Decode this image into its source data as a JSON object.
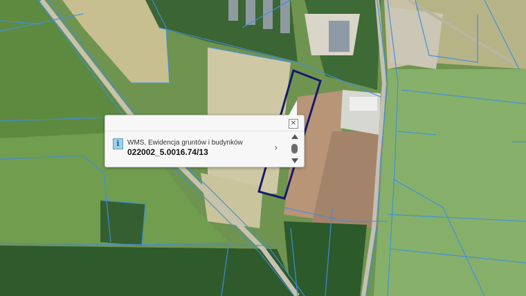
{
  "map": {
    "colors": {
      "parcel_lines": "#3f8fe0",
      "selected_parcel": "#141a6b",
      "field": "#7fa85a",
      "forest": "#2f5a2c"
    }
  },
  "popup": {
    "close_icon": "close-icon",
    "info_icon_glyph": "i",
    "layer_name": "WMS, Ewidencja gruntów i budynków",
    "feature_id": "022002_5.0016.74/13",
    "next_glyph": "›"
  }
}
